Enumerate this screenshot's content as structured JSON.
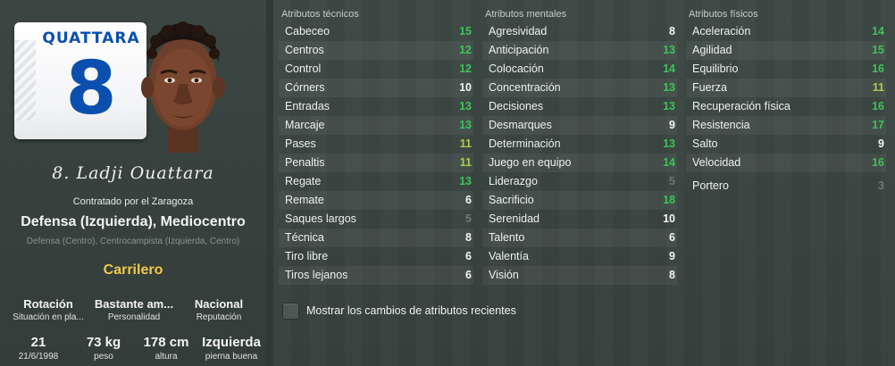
{
  "colors": {
    "high": "#3ec25a",
    "mid": "#a6d24b",
    "white": "#f2f4f3",
    "low": "#6d7873",
    "role": "#f0c84a",
    "shirt_blue": "#0b4fae"
  },
  "player": {
    "shirt_name": "QUATTARA",
    "shirt_number": "8",
    "full_name": "8. Ladji Ouattara",
    "contract": "Contratado por el Zaragoza",
    "main_position": "Defensa (Izquierda), Mediocentro",
    "secondary_positions": "Defensa (Centro), Centrocampista (Izquierda, Centro)",
    "role": "Carrilero",
    "status": [
      {
        "value": "Rotación",
        "label": "Situación en pla..."
      },
      {
        "value": "Bastante am...",
        "label": "Personalidad"
      },
      {
        "value": "Nacional",
        "label": "Reputación"
      }
    ],
    "physical": [
      {
        "value": "21",
        "label": "21/6/1998"
      },
      {
        "value": "73 kg",
        "label": "peso"
      },
      {
        "value": "178 cm",
        "label": "altura"
      },
      {
        "value": "Izquierda",
        "label": "pierna buena"
      }
    ]
  },
  "attributes": {
    "technical": {
      "title": "Atributos técnicos",
      "items": [
        {
          "name": "Cabeceo",
          "value": "15",
          "level": "high"
        },
        {
          "name": "Centros",
          "value": "12",
          "level": "high"
        },
        {
          "name": "Control",
          "value": "12",
          "level": "high"
        },
        {
          "name": "Córners",
          "value": "10",
          "level": "white"
        },
        {
          "name": "Entradas",
          "value": "13",
          "level": "high"
        },
        {
          "name": "Marcaje",
          "value": "13",
          "level": "high"
        },
        {
          "name": "Pases",
          "value": "11",
          "level": "mid"
        },
        {
          "name": "Penaltis",
          "value": "11",
          "level": "mid"
        },
        {
          "name": "Regate",
          "value": "13",
          "level": "high"
        },
        {
          "name": "Remate",
          "value": "6",
          "level": "white"
        },
        {
          "name": "Saques largos",
          "value": "5",
          "level": "low"
        },
        {
          "name": "Técnica",
          "value": "8",
          "level": "white"
        },
        {
          "name": "Tiro libre",
          "value": "6",
          "level": "white"
        },
        {
          "name": "Tiros lejanos",
          "value": "6",
          "level": "white"
        }
      ]
    },
    "mental": {
      "title": "Atributos mentales",
      "items": [
        {
          "name": "Agresividad",
          "value": "8",
          "level": "white"
        },
        {
          "name": "Anticipación",
          "value": "13",
          "level": "high"
        },
        {
          "name": "Colocación",
          "value": "14",
          "level": "high"
        },
        {
          "name": "Concentración",
          "value": "13",
          "level": "high"
        },
        {
          "name": "Decisiones",
          "value": "13",
          "level": "high"
        },
        {
          "name": "Desmarques",
          "value": "9",
          "level": "white"
        },
        {
          "name": "Determinación",
          "value": "13",
          "level": "high"
        },
        {
          "name": "Juego en equipo",
          "value": "14",
          "level": "high"
        },
        {
          "name": "Liderazgo",
          "value": "5",
          "level": "low"
        },
        {
          "name": "Sacrificio",
          "value": "18",
          "level": "high"
        },
        {
          "name": "Serenidad",
          "value": "10",
          "level": "white"
        },
        {
          "name": "Talento",
          "value": "6",
          "level": "white"
        },
        {
          "name": "Valentía",
          "value": "9",
          "level": "white"
        },
        {
          "name": "Visión",
          "value": "8",
          "level": "white"
        }
      ]
    },
    "physical": {
      "title": "Atributos físicos",
      "items": [
        {
          "name": "Aceleración",
          "value": "14",
          "level": "high"
        },
        {
          "name": "Agilidad",
          "value": "15",
          "level": "high"
        },
        {
          "name": "Equilibrio",
          "value": "16",
          "level": "high"
        },
        {
          "name": "Fuerza",
          "value": "11",
          "level": "mid"
        },
        {
          "name": "Recuperación física",
          "value": "16",
          "level": "high"
        },
        {
          "name": "Resistencia",
          "value": "17",
          "level": "high"
        },
        {
          "name": "Salto",
          "value": "9",
          "level": "white"
        },
        {
          "name": "Velocidad",
          "value": "16",
          "level": "high"
        }
      ],
      "goalkeeper": {
        "name": "Portero",
        "value": "3",
        "level": "low"
      }
    }
  },
  "show_changes_label": "Mostrar los cambios de atributos recientes"
}
